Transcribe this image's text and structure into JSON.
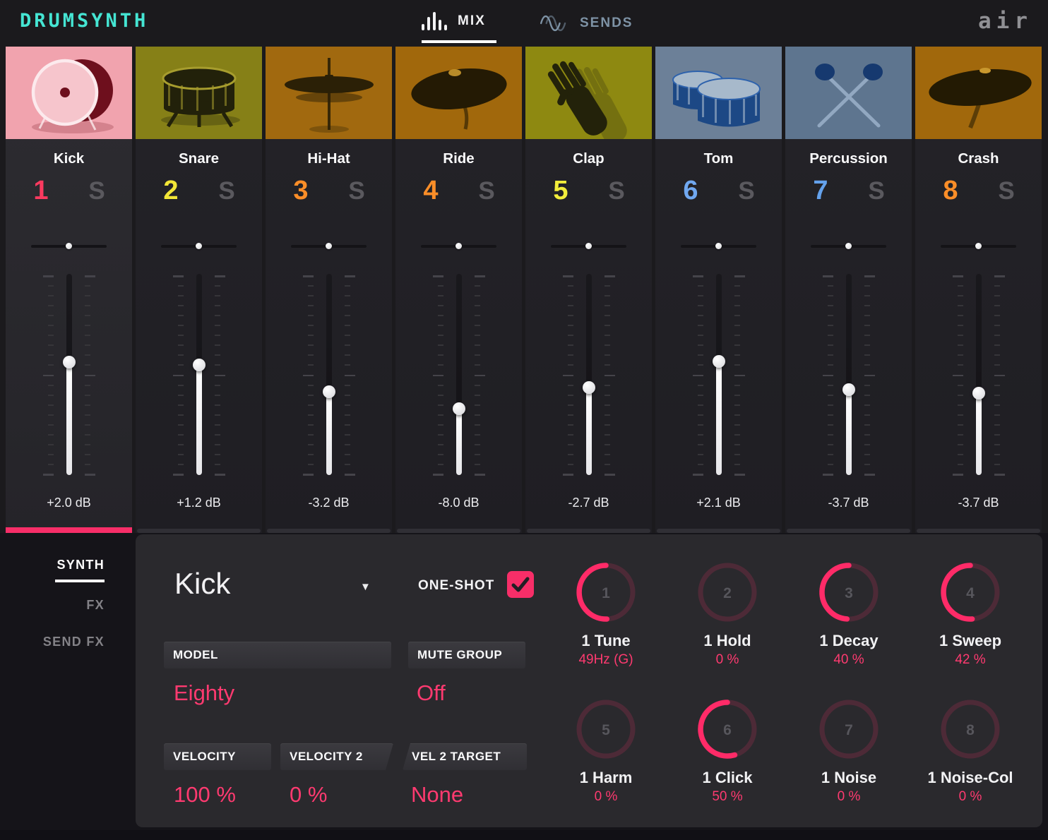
{
  "header": {
    "logo": "DRUMSYNTH",
    "tabs": [
      {
        "label": "MIX",
        "active": true
      },
      {
        "label": "SENDS",
        "active": false
      }
    ],
    "brand": "air"
  },
  "colors": {
    "accent": "#F72E68",
    "logo": "#45E5D3",
    "sends_tab": "#7E93A6"
  },
  "channels": [
    {
      "name": "Kick",
      "number": "1",
      "number_color": "#fa3a5f",
      "solo": "S",
      "db": "+2.0 dB",
      "pan_percent": 50,
      "fader_percent": 43.5,
      "selected": true,
      "image": "kick",
      "art": {
        "bg": "#f1a3ae",
        "ink": "#6e0f1d",
        "hi": "#f6c5cc",
        "rim": "#fceaed"
      }
    },
    {
      "name": "Snare",
      "number": "2",
      "number_color": "#f2e637",
      "solo": "S",
      "db": "+1.2 dB",
      "pan_percent": 50,
      "fader_percent": 45,
      "selected": false,
      "image": "snare",
      "art": {
        "bg": "#868017",
        "ink": "#22210a",
        "hi": "#a79d2e"
      }
    },
    {
      "name": "Hi-Hat",
      "number": "3",
      "number_color": "#fa8e28",
      "solo": "S",
      "db": "-3.2 dB",
      "pan_percent": 50,
      "fader_percent": 59,
      "selected": false,
      "image": "hihat",
      "art": {
        "bg": "#a1690f",
        "ink": "#2b2006",
        "hi": "#7d5a13"
      }
    },
    {
      "name": "Ride",
      "number": "4",
      "number_color": "#fa8e28",
      "solo": "S",
      "db": "-8.0 dB",
      "pan_percent": 50,
      "fader_percent": 68,
      "selected": false,
      "image": "ride",
      "art": {
        "bg": "#a1680c",
        "ink": "#241a04",
        "hi": "#c9982e"
      }
    },
    {
      "name": "Clap",
      "number": "5",
      "number_color": "#f2ed3b",
      "solo": "S",
      "db": "-2.7 dB",
      "pan_percent": 50,
      "fader_percent": 57,
      "selected": false,
      "image": "clap",
      "art": {
        "bg": "#8e8911",
        "ink": "#23220a",
        "hi": "#6e6a10"
      }
    },
    {
      "name": "Tom",
      "number": "6",
      "number_color": "#70a8f0",
      "solo": "S",
      "db": "+2.1 dB",
      "pan_percent": 50,
      "fader_percent": 43,
      "selected": false,
      "image": "tom",
      "art": {
        "bg": "#6c8098",
        "ink": "#1c4885",
        "hi": "#a7b9cb",
        "line": "#2e62ac"
      }
    },
    {
      "name": "Percussion",
      "number": "7",
      "number_color": "#64a2ec",
      "solo": "S",
      "db": "-3.7 dB",
      "pan_percent": 50,
      "fader_percent": 58,
      "selected": false,
      "image": "perc",
      "art": {
        "bg": "#5e758f",
        "ink": "#16396f",
        "hi": "#92a8c1"
      }
    },
    {
      "name": "Crash",
      "number": "8",
      "number_color": "#fa8e28",
      "solo": "S",
      "db": "-3.7 dB",
      "pan_percent": 50,
      "fader_percent": 60,
      "selected": false,
      "image": "crash",
      "art": {
        "bg": "#a1680c",
        "ink": "#231a03",
        "hi": "#c9982e"
      }
    }
  ],
  "sidebar": {
    "items": [
      {
        "label": "SYNTH",
        "active": true
      },
      {
        "label": "FX",
        "active": false
      },
      {
        "label": "SEND FX",
        "active": false
      }
    ]
  },
  "panel": {
    "preset_name": "Kick",
    "oneshot_label": "ONE-SHOT",
    "oneshot_checked": true,
    "params": [
      {
        "label": "MODEL",
        "value": "Eighty"
      },
      {
        "label": "MUTE GROUP",
        "value": "Off"
      },
      {
        "label": "VELOCITY",
        "value": "100 %"
      },
      {
        "label": "VELOCITY 2",
        "value": "0 %"
      },
      {
        "label": "VEL 2 TARGET",
        "value": "None"
      }
    ],
    "knobs": [
      {
        "number": "1",
        "label": "1 Tune",
        "value": "49Hz (G)",
        "arc_deg": 182
      },
      {
        "number": "2",
        "label": "1 Hold",
        "value": "0 %",
        "arc_deg": 0
      },
      {
        "number": "3",
        "label": "1 Decay",
        "value": "40 %",
        "arc_deg": 176
      },
      {
        "number": "4",
        "label": "1 Sweep",
        "value": "42 %",
        "arc_deg": 184
      },
      {
        "number": "5",
        "label": "1 Harm",
        "value": "0 %",
        "arc_deg": 0
      },
      {
        "number": "6",
        "label": "1 Click",
        "value": "50 %",
        "arc_deg": 196
      },
      {
        "number": "7",
        "label": "1 Noise",
        "value": "0 %",
        "arc_deg": 0
      },
      {
        "number": "8",
        "label": "1 Noise-Col",
        "value": "0 %",
        "arc_deg": 0
      }
    ]
  }
}
